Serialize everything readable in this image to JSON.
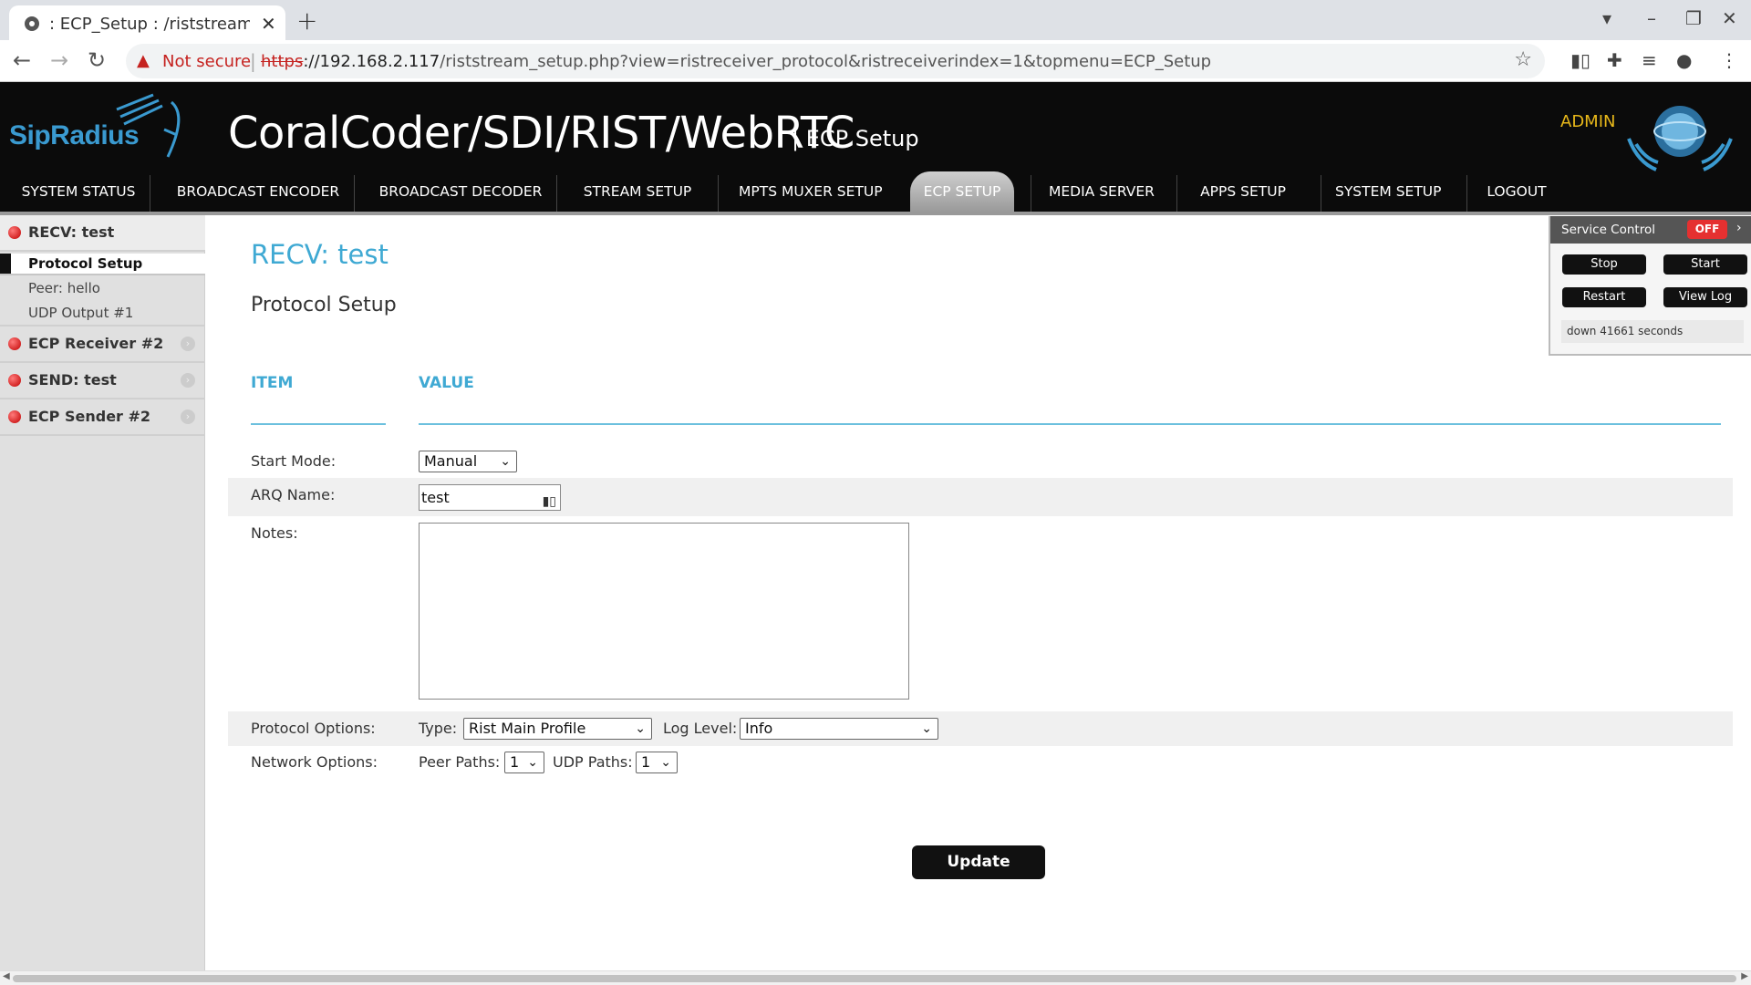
{
  "browser": {
    "tab_title": ": ECP_Setup : /riststream_",
    "security_label": "Not secure",
    "url_protocol": "https",
    "url_host": "://192.168.2.117",
    "url_path": "/riststream_setup.php?view=ristreceiver_protocol&ristreceiverindex=1&topmenu=ECP_Setup"
  },
  "header": {
    "logo_text": "SipRadius",
    "app_title": "CoralCoder/SDI/RIST/WebRTC",
    "app_subtitle": "| ECP Setup",
    "user": "ADMIN"
  },
  "topnav": [
    {
      "label": "SYSTEM STATUS"
    },
    {
      "label": "BROADCAST ENCODER"
    },
    {
      "label": "BROADCAST DECODER"
    },
    {
      "label": "STREAM SETUP"
    },
    {
      "label": "MPTS MUXER SETUP"
    },
    {
      "label": "ECP SETUP",
      "active": true
    },
    {
      "label": "MEDIA SERVER"
    },
    {
      "label": "APPS SETUP"
    },
    {
      "label": "SYSTEM SETUP"
    },
    {
      "label": "LOGOUT"
    }
  ],
  "sidebar": {
    "groups": [
      {
        "label": "RECV: test",
        "items": [
          "Protocol Setup",
          "Peer: hello",
          "UDP Output #1"
        ]
      },
      {
        "label": "ECP Receiver #2"
      },
      {
        "label": "SEND: test"
      },
      {
        "label": "ECP Sender #2"
      }
    ],
    "status_color": "#d00000"
  },
  "main": {
    "title": "RECV: test",
    "subtitle": "Protocol Setup",
    "col_item": "ITEM",
    "col_value": "VALUE",
    "fields": {
      "start_mode": {
        "label": "Start Mode:",
        "value": "Manual"
      },
      "arq_name": {
        "label": "ARQ Name:",
        "value": "test"
      },
      "notes": {
        "label": "Notes:",
        "value": ""
      },
      "protocol_options": {
        "label": "Protocol Options:",
        "type_label": "Type:",
        "type_value": "Rist Main Profile",
        "log_label": "Log Level:",
        "log_value": "Info"
      },
      "network_options": {
        "label": "Network Options:",
        "peer_label": "Peer Paths:",
        "peer_value": "1",
        "udp_label": "UDP Paths:",
        "udp_value": "1"
      }
    },
    "update_label": "Update",
    "accent_color": "#3fa9d3"
  },
  "service_control": {
    "title": "Service Control",
    "state": "OFF",
    "buttons": [
      "Stop",
      "Start",
      "Restart",
      "View Log"
    ],
    "status": "down 41661 seconds"
  }
}
